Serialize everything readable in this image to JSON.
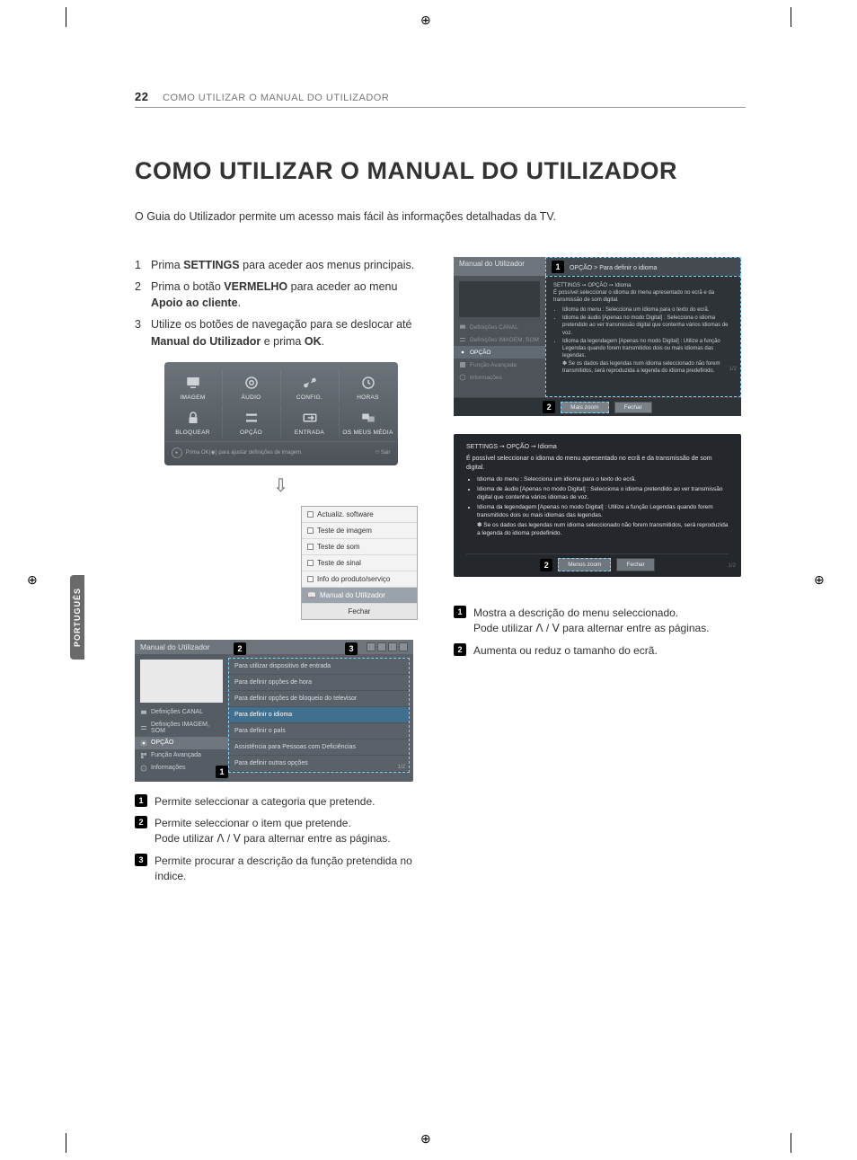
{
  "page_number": "22",
  "running_head": "COMO UTILIZAR O MANUAL DO UTILIZADOR",
  "language_tab": "PORTUGUÊS",
  "title": "COMO UTILIZAR O MANUAL DO UTILIZADOR",
  "intro": "O Guia do Utilizador permite um acesso mais fácil às informações detalhadas da TV.",
  "steps": {
    "s1_pre": "Prima ",
    "s1_b": "SETTINGS",
    "s1_post": " para aceder aos menus principais.",
    "s2_pre": "Prima o botão ",
    "s2_b": "VERMELHO",
    "s2_mid": " para aceder ao menu ",
    "s2_b2": "Apoio ao cliente",
    "s2_post": ".",
    "s3_pre": "Utilize os botões de navegação para se deslocar até ",
    "s3_b": "Manual do Utilizador",
    "s3_mid": " e prima ",
    "s3_b2": "OK",
    "s3_post": "."
  },
  "tv_menu": {
    "row1": [
      "IMAGEM",
      "ÁUDIO",
      "CONFIG.",
      "HORAS"
    ],
    "row2": [
      "BLOQUEAR",
      "OPÇÃO",
      "ENTRADA",
      "OS MEUS MÉDIA"
    ],
    "hint": "Prima OK(◉) para ajustar definições de imagem.",
    "exit": "Sair"
  },
  "support_popup": {
    "items": [
      "Actualiz. software",
      "Teste de imagem",
      "Teste de som",
      "Teste de sinal",
      "Info do produto/serviço",
      "Manual do Utilizador"
    ],
    "close": "Fechar"
  },
  "manual_browser": {
    "title": "Manual do Utilizador",
    "sidebar": [
      "Definições CANAL",
      "Definições IMAGEM, SOM",
      "OPÇÃO",
      "Função Avançada",
      "Informações"
    ],
    "pane": [
      "Para utilizar dispositivo de entrada",
      "Para definir opções de hora",
      "Para definir opções de bloqueio do televisor",
      "Para definir o idioma",
      "Para definir o país",
      "Assistência para Pessoas com Deficiências",
      "Para definir outras opções"
    ],
    "selected_pane_index": 3,
    "pagenum": "1/2"
  },
  "left_notes": {
    "n1": "Permite seleccionar a categoria que pretende.",
    "n2a": "Permite seleccionar o item que pretende.",
    "n2b_pre": "Pode utilizar ",
    "n2b_post": " para alternar entre as páginas.",
    "n3": "Permite procurar a descrição da função pretendida no índice."
  },
  "detail1": {
    "title": "Manual do Utilizador",
    "breadcrumb": "OPÇÃO > Para definir o idioma",
    "crumb2": "SETTINGS ➙ OPÇÃO ➙ Idioma",
    "lead": "É possível seleccionar o idioma do menu apresentado no ecrã e da transmissão de som digital.",
    "bul1": "Idioma do menu : Selecciona um idioma para o texto do ecrã.",
    "bul2": "Idioma de áudio [Apenas no modo Digital] : Selecciona o idioma pretendido ao ver transmissão digital que contenha vários idiomas de voz.",
    "bul3": "Idioma da legendagem [Apenas no modo Digital] : Utilize a função Legendas quando forem transmitidos dois ou mais idiomas das legendas.",
    "ast": "✽ Se os dados das legendas num idioma seleccionado não forem transmitidos, será reproduzida a legenda do idioma predefinido.",
    "sidebar": [
      "Definições CANAL",
      "Definições IMAGEM, SOM",
      "OPÇÃO",
      "Função Avançada",
      "Informações"
    ],
    "zoom": "Mais zoom",
    "close": "Fechar",
    "pagenum": "1/2"
  },
  "detail2": {
    "crumb": "SETTINGS ➙ OPÇÃO ➙ Idioma",
    "lead": "É possível seleccionar o idioma do menu apresentado no ecrã e da transmissão de som digital.",
    "bul1": "Idioma do menu : Selecciona um idioma para o texto do ecrã.",
    "bul2": "Idioma de áudio [Apenas no modo Digital] : Selecciona o idioma pretendido ao ver transmissão digital que contenha vários idiomas de voz.",
    "bul3": "Idioma da legendagem [Apenas no modo Digital] : Utilize a função Legendas quando forem transmitidos dois ou mais idiomas das legendas.",
    "ast": "✽ Se os dados das legendas num idioma seleccionado não forem transmitidos, será reproduzida a legenda do idioma predefinido.",
    "zoom": "Menos zoom",
    "close": "Fechar",
    "pagenum": "1/2"
  },
  "right_notes": {
    "n1a": "Mostra a descrição do menu seleccionado.",
    "n1b_pre": "Pode utilizar ",
    "n1b_post": " para alternar entre as páginas.",
    "n2": "Aumenta ou reduz o tamanho do ecrã."
  }
}
